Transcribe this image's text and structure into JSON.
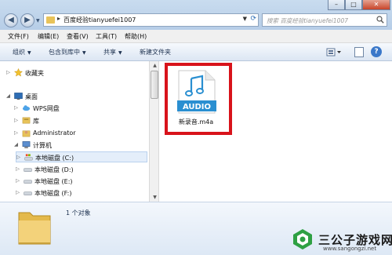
{
  "address_bar": {
    "path": "百度经验tianyuefei1007",
    "separator": "▸",
    "search_placeholder": "搜索 百度经验tianyuefei1007"
  },
  "window_buttons": {
    "minimize": "–",
    "maximize": "□",
    "close": "✕"
  },
  "menu": [
    {
      "label": "文件(F)"
    },
    {
      "label": "编辑(E)"
    },
    {
      "label": "查看(V)"
    },
    {
      "label": "工具(T)"
    },
    {
      "label": "帮助(H)"
    }
  ],
  "command_bar": {
    "organize": "组织",
    "include_library": "包含到库中",
    "share": "共享",
    "new_folder": "新建文件夹",
    "help": "?"
  },
  "nav_tree": [
    {
      "label": "收藏夹",
      "icon": "star-icon"
    },
    {
      "label": "桌面",
      "icon": "desktop-icon"
    },
    {
      "label": "WPS网盘",
      "icon": "cloud-icon"
    },
    {
      "label": "库",
      "icon": "library-icon"
    },
    {
      "label": "Administrator",
      "icon": "user-folder-icon"
    },
    {
      "label": "计算机",
      "icon": "computer-icon"
    },
    {
      "label": "本地磁盘 (C:)",
      "icon": "system-drive-icon"
    },
    {
      "label": "本地磁盘 (D:)",
      "icon": "drive-icon"
    },
    {
      "label": "本地磁盘 (E:)",
      "icon": "drive-icon"
    },
    {
      "label": "本地磁盘 (F:)",
      "icon": "drive-icon"
    }
  ],
  "file": {
    "icon_label": "AUDIO",
    "name": "新录音.m4a",
    "icon_color": "#2a8fd1",
    "highlight_color": "#d8131b"
  },
  "details": {
    "count": "1 个对象"
  },
  "watermark": {
    "text": "三公子游戏网",
    "url": "www.sangongzi.net"
  }
}
